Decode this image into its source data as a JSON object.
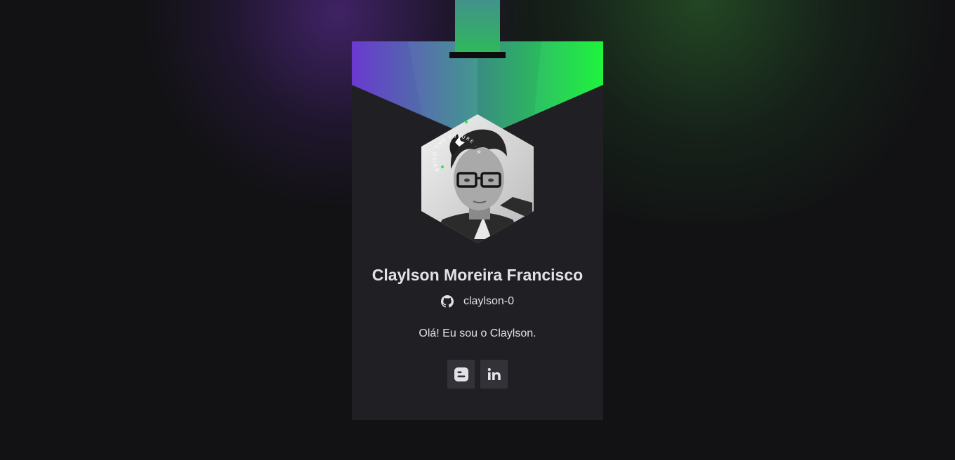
{
  "profile": {
    "name": "Claylson Moreira Francisco",
    "github_username": "claylson-0",
    "bio": "Olá! Eu sou o Claylson.",
    "avatar_badge_text": "BUILD THE FUTURE · ROCKETSEAT"
  },
  "socials": [
    {
      "icon": "blogger-icon",
      "label": "Blogger"
    },
    {
      "icon": "linkedin-icon",
      "label": "LinkedIn"
    }
  ],
  "colors": {
    "background": "#121214",
    "card": "#202024",
    "gradient_start": "#6a3ad0",
    "gradient_end": "#1ff33c",
    "text": "#e1e1e6",
    "social_button": "#323238"
  }
}
